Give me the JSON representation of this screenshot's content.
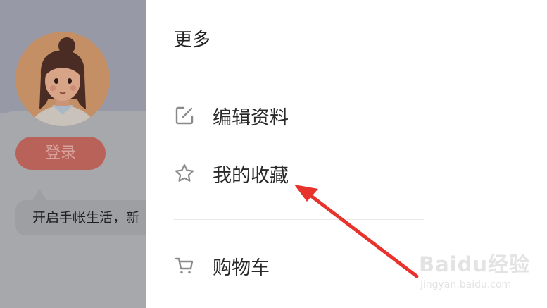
{
  "background_page": {
    "login_label": "登录",
    "tip_text": "开启手帐生活，新"
  },
  "drawer": {
    "title": "更多",
    "items": [
      {
        "label": "编辑资料",
        "icon": "edit-icon"
      },
      {
        "label": "我的收藏",
        "icon": "star-icon"
      },
      {
        "label": "购物车",
        "icon": "cart-icon"
      }
    ]
  },
  "watermark": {
    "logo": "Baidu经验",
    "url": "jingyan.baidu.com"
  },
  "colors": {
    "annotation_arrow": "#e8322c",
    "login_button": "#b9625a",
    "icon_gray": "#8a8a8a"
  }
}
